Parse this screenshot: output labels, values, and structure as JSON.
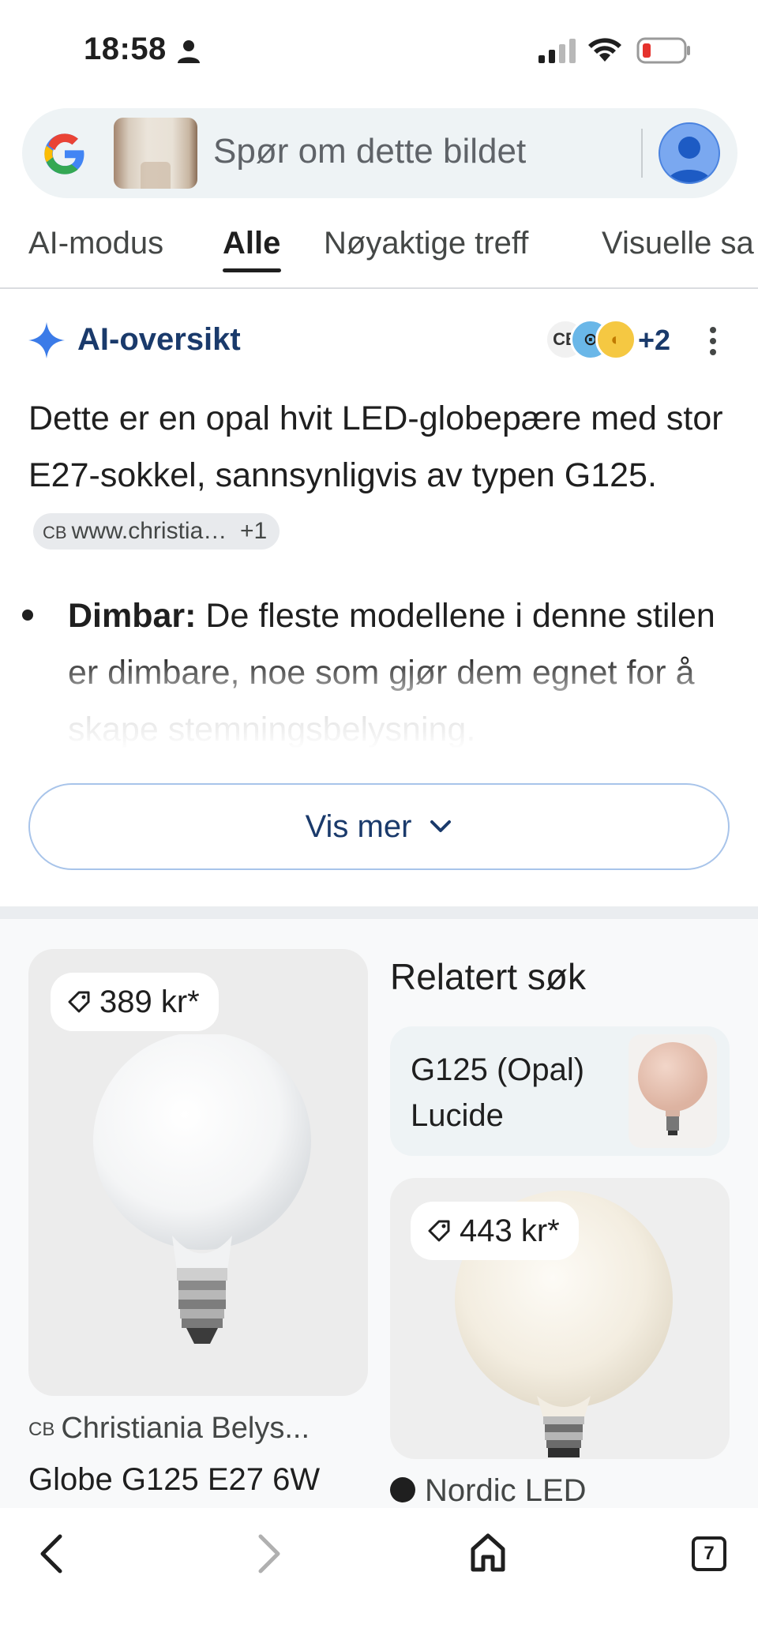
{
  "status_bar": {
    "time": "18:58",
    "icons": [
      "person-icon",
      "cellular-signal-icon",
      "wifi-icon",
      "battery-low-icon"
    ]
  },
  "search": {
    "placeholder": "Spør om dette bildet",
    "logo_icon": "google-g-icon",
    "thumbnail": "query-image-thumbnail",
    "account_icon": "account-avatar-icon"
  },
  "tabs": [
    {
      "label": "AI-modus",
      "active": false
    },
    {
      "label": "Alle",
      "active": true
    },
    {
      "label": "Nøyaktige treff",
      "active": false
    },
    {
      "label": "Visuelle sa",
      "active": false
    }
  ],
  "ai_overview": {
    "title": "AI-oversikt",
    "sources_more": "+2",
    "paragraph": "Dette er en opal hvit LED-globepære med stor E27-sokkel, sannsynligvis av typen G125.",
    "chip_label": "www.christia…",
    "chip_count": "+1",
    "bullet_bold": "Dimbar:",
    "bullet_text": " De fleste modellene i denne stilen er dimbare, noe som gjør dem egnet for å skape stemningsbelysning.",
    "show_more": "Vis mer",
    "accent_color": "#1a3a6b"
  },
  "products": {
    "card1": {
      "price": "389 kr*",
      "source": "Christiania Belys...",
      "title": "Globe G125 E27 6W"
    },
    "related": {
      "heading": "Relatert søk",
      "item_label": "G125 (Opal) Lucide"
    },
    "card2": {
      "price": "443 kr*",
      "source": "Nordic LED"
    }
  },
  "bottom_nav": {
    "tab_count": "7"
  }
}
